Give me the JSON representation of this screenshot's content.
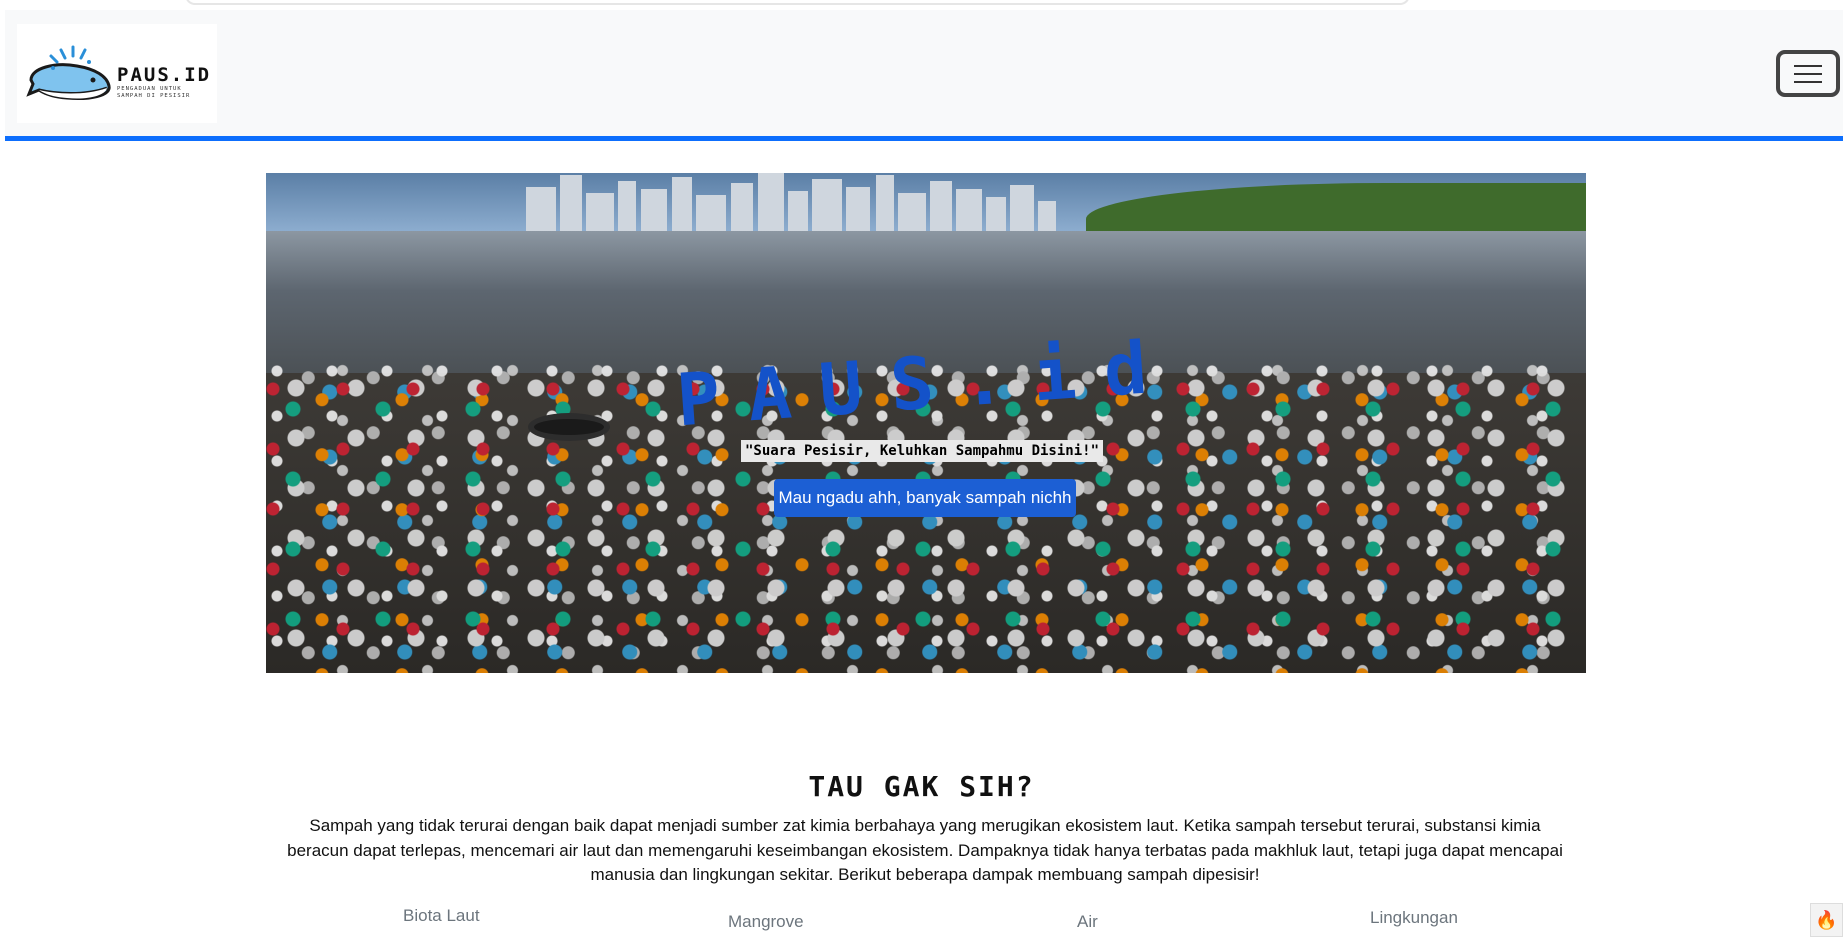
{
  "navbar": {
    "logo": {
      "title": "PAUS.ID",
      "subtitle_line1": "PENGADUAN UNTUK",
      "subtitle_line2": "SAMPAH DI PESISIR"
    },
    "menu_icon": "hamburger-menu-icon"
  },
  "hero": {
    "title": "PAUS.id",
    "tagline": "\"Suara Pesisir, Keluhkan Sampahmu Disini!\"",
    "cta_label": "Mau ngadu ahh, banyak sampah nichh"
  },
  "info": {
    "title": "TAU GAK SIH?",
    "text": "Sampah yang tidak terurai dengan baik dapat menjadi sumber zat kimia berbahaya yang merugikan ekosistem laut. Ketika sampah tersebut terurai, substansi kimia beracun dapat terlepas, mencemari air laut dan memengaruhi keseimbangan ekosistem. Dampaknya tidak hanya terbatas pada makhluk laut, tetapi juga dapat mencapai manusia dan lingkungan sekitar. Berikut beberapa dampak membuang sampah dipesisir!",
    "categories": [
      "Biota Laut",
      "Mangrove",
      "Air",
      "Lingkungan"
    ]
  },
  "colors": {
    "accent": "#0d6efd",
    "button": "#1c5fd4",
    "hero_title": "#1452c9"
  }
}
